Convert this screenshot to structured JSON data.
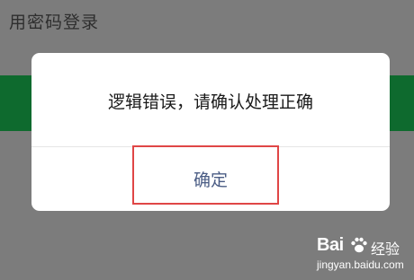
{
  "background": {
    "title": "用密码登录"
  },
  "dialog": {
    "message": "逻辑错误，请确认处理正确",
    "confirm_label": "确定"
  },
  "watermark": {
    "logo": "Bai",
    "product": "经验",
    "url": "jingyan.baidu.com"
  },
  "colors": {
    "overlay": "#7c7c7c",
    "brand_green": "#0e6a2e",
    "dialog_bg": "#ffffff",
    "confirm_text": "#4a5c84",
    "highlight": "#e04646"
  },
  "icons": {
    "watermark_logo": "paw-icon"
  }
}
